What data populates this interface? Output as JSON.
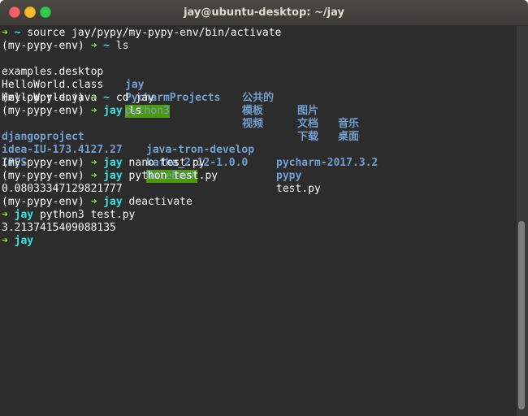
{
  "window": {
    "title": "jay@ubuntu-desktop: ~/jay"
  },
  "colors": {
    "prompt_arrow": "#8ae234",
    "cwd": "#34e2e2",
    "directory": "#729fcf",
    "highlight_bg": "#4e9a06",
    "text": "#ffffff",
    "background": "#2c2c2c"
  },
  "icons": {
    "close": "close-window-icon",
    "minimize": "minimize-window-icon",
    "maximize": "maximize-window-icon"
  },
  "terminal": {
    "arrow": "➜",
    "home": "~",
    "cwd": "jay",
    "venv": "(my-pypy-env)",
    "cmd_source": "source jay/pypy/my-pypy-env/bin/activate",
    "cmd_ls": "ls",
    "cmd_cd": "cd jay",
    "cmd_nano": "nano test.py",
    "cmd_python": "python test.py",
    "cmd_deactivate": "deactivate",
    "cmd_python3": "python3 test.py",
    "ls_home": {
      "c1": [
        "examples.desktop",
        "HelloWorld.class",
        "HelloWorld.java"
      ],
      "c2": [
        "jay",
        "PycharmProjects",
        "python3"
      ],
      "c3": [
        "公共的",
        "模板",
        "视频"
      ],
      "c4": [
        "图片",
        "文档",
        "下载"
      ],
      "c5": [
        "音乐",
        "桌面"
      ]
    },
    "ls_jay": {
      "c1": [
        "djangoproject",
        "idea-IU-173.4127.27",
        "IPFS"
      ],
      "c2": [
        "java-tron-develop",
        "kafka_2.12-1.0.0",
        "NoteBook"
      ],
      "c3": [
        "pycharm-2017.3.2",
        "pypy",
        "test.py"
      ]
    },
    "output_python": "0.08033347129821777",
    "output_python3": "3.2137415409088135"
  }
}
